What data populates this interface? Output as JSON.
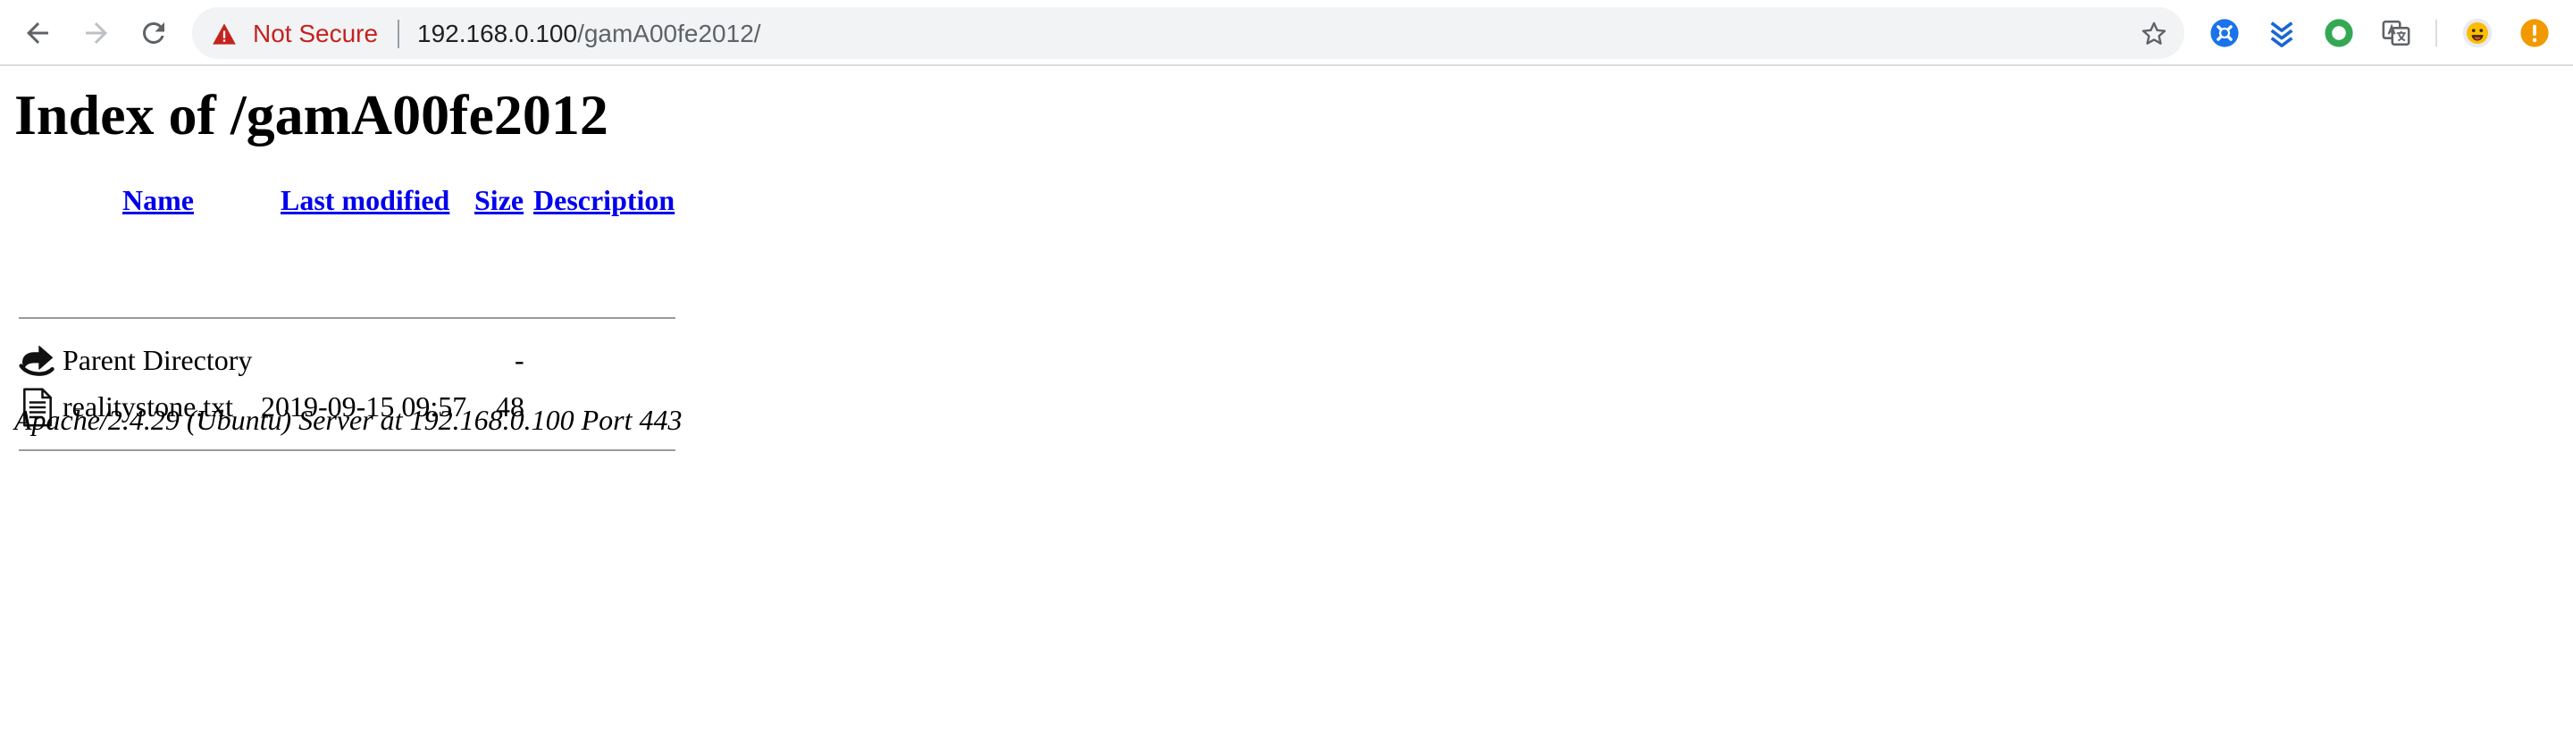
{
  "browser": {
    "security_label": "Not Secure",
    "url_host": "192.168.0.100",
    "url_path": "/gamA00fe2012/",
    "icons": [
      "back-arrow-icon",
      "forward-arrow-icon",
      "reload-icon",
      "warning-triangle-icon",
      "star-bookmark-icon"
    ],
    "extensions": [
      "blue-compass-extension-icon",
      "blue-chevrons-extension-icon",
      "green-ring-extension-icon",
      "translate-extension-icon",
      "smiley-avatar-icon",
      "orange-alert-icon"
    ]
  },
  "page": {
    "title": "Index of /gamA00fe2012",
    "columns": {
      "name": "Name",
      "last_modified": "Last modified",
      "size": "Size",
      "description": "Description"
    },
    "rows": [
      {
        "icon": "back-arrow-folder-icon",
        "name": "Parent Directory",
        "modified": "",
        "size": "-",
        "description": ""
      },
      {
        "icon": "text-file-icon",
        "name": "realitystone.txt",
        "modified": "2019-09-15 09:57",
        "size": "48",
        "description": ""
      }
    ],
    "footer": "Apache/2.4.29 (Ubuntu) Server at 192.168.0.100 Port 443"
  },
  "colors": {
    "link": "#0000ee",
    "not_secure": "#c5221f",
    "omnibox_bg": "#f1f3f4"
  }
}
